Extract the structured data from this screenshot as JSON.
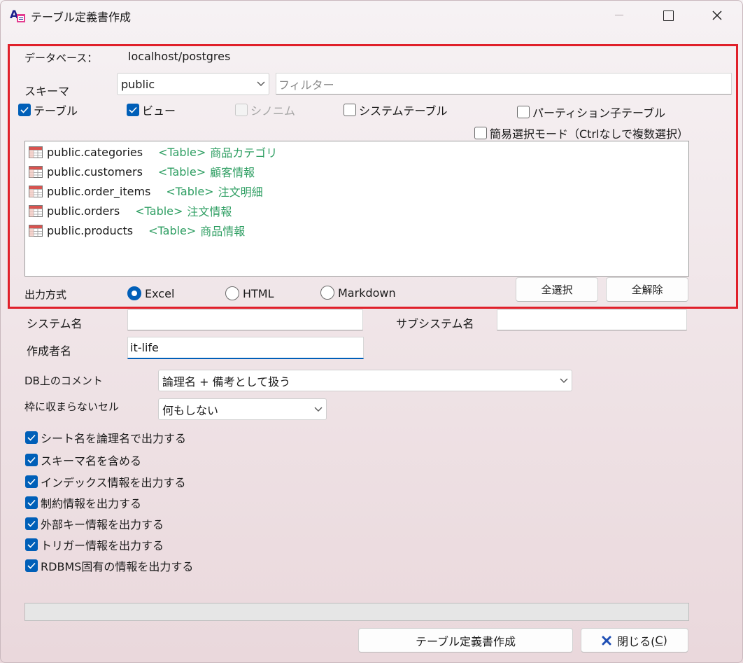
{
  "window": {
    "title": "テーブル定義書作成"
  },
  "database": {
    "label": "データベース：",
    "value": "localhost/postgres"
  },
  "schema": {
    "label": "スキーマ",
    "selected": "public",
    "filter_placeholder": "フィルター"
  },
  "object_filters": [
    {
      "label": "テーブル",
      "checked": true,
      "enabled": true
    },
    {
      "label": "ビュー",
      "checked": true,
      "enabled": true
    },
    {
      "label": "シノニム",
      "checked": false,
      "enabled": false
    },
    {
      "label": "システムテーブル",
      "checked": false,
      "enabled": true
    },
    {
      "label": "パーティション子テーブル",
      "checked": false,
      "enabled": true
    }
  ],
  "simple_select": {
    "label": "簡易選択モード（Ctrlなしで複数選択）",
    "checked": false
  },
  "tables": [
    {
      "name": "public.categories",
      "type": "<Table>",
      "comment": "商品カテゴリ"
    },
    {
      "name": "public.customers",
      "type": "<Table>",
      "comment": "顧客情報"
    },
    {
      "name": "public.order_items",
      "type": "<Table>",
      "comment": "注文明細"
    },
    {
      "name": "public.orders",
      "type": "<Table>",
      "comment": "注文情報"
    },
    {
      "name": "public.products",
      "type": "<Table>",
      "comment": "商品情報"
    }
  ],
  "output": {
    "label": "出力方式",
    "options": [
      "Excel",
      "HTML",
      "Markdown"
    ],
    "selected": "Excel"
  },
  "buttons": {
    "select_all": "全選択",
    "deselect_all": "全解除",
    "create": "テーブル定義書作成",
    "close": "閉じる(C)",
    "close_text": "閉じる(",
    "close_key": "C",
    "close_end": ")"
  },
  "system_name": {
    "label": "システム名",
    "value": ""
  },
  "subsystem_name": {
    "label": "サブシステム名",
    "value": ""
  },
  "author": {
    "label": "作成者名",
    "value": "it-life"
  },
  "db_comment": {
    "label": "DB上のコメント",
    "selected": "論理名 + 備考として扱う"
  },
  "overflow_cell": {
    "label": "枠に収まらないセル",
    "selected": "何もしない"
  },
  "options": [
    {
      "label": "シート名を論理名で出力する",
      "checked": true
    },
    {
      "label": "スキーマ名を含める",
      "checked": true
    },
    {
      "label": "インデックス情報を出力する",
      "checked": true
    },
    {
      "label": "制約情報を出力する",
      "checked": true
    },
    {
      "label": "外部キー情報を出力する",
      "checked": true
    },
    {
      "label": "トリガー情報を出力する",
      "checked": true
    },
    {
      "label": "RDBMS固有の情報を出力する",
      "checked": true
    }
  ],
  "progress": {
    "value": 0
  },
  "colors": {
    "accent": "#005fb8",
    "highlight_frame": "#e0202a",
    "comment_text": "#2e9e62"
  },
  "icons": {
    "app": "app-logo-icon",
    "table": "table-grid-icon",
    "close_button": "x-close-icon"
  }
}
